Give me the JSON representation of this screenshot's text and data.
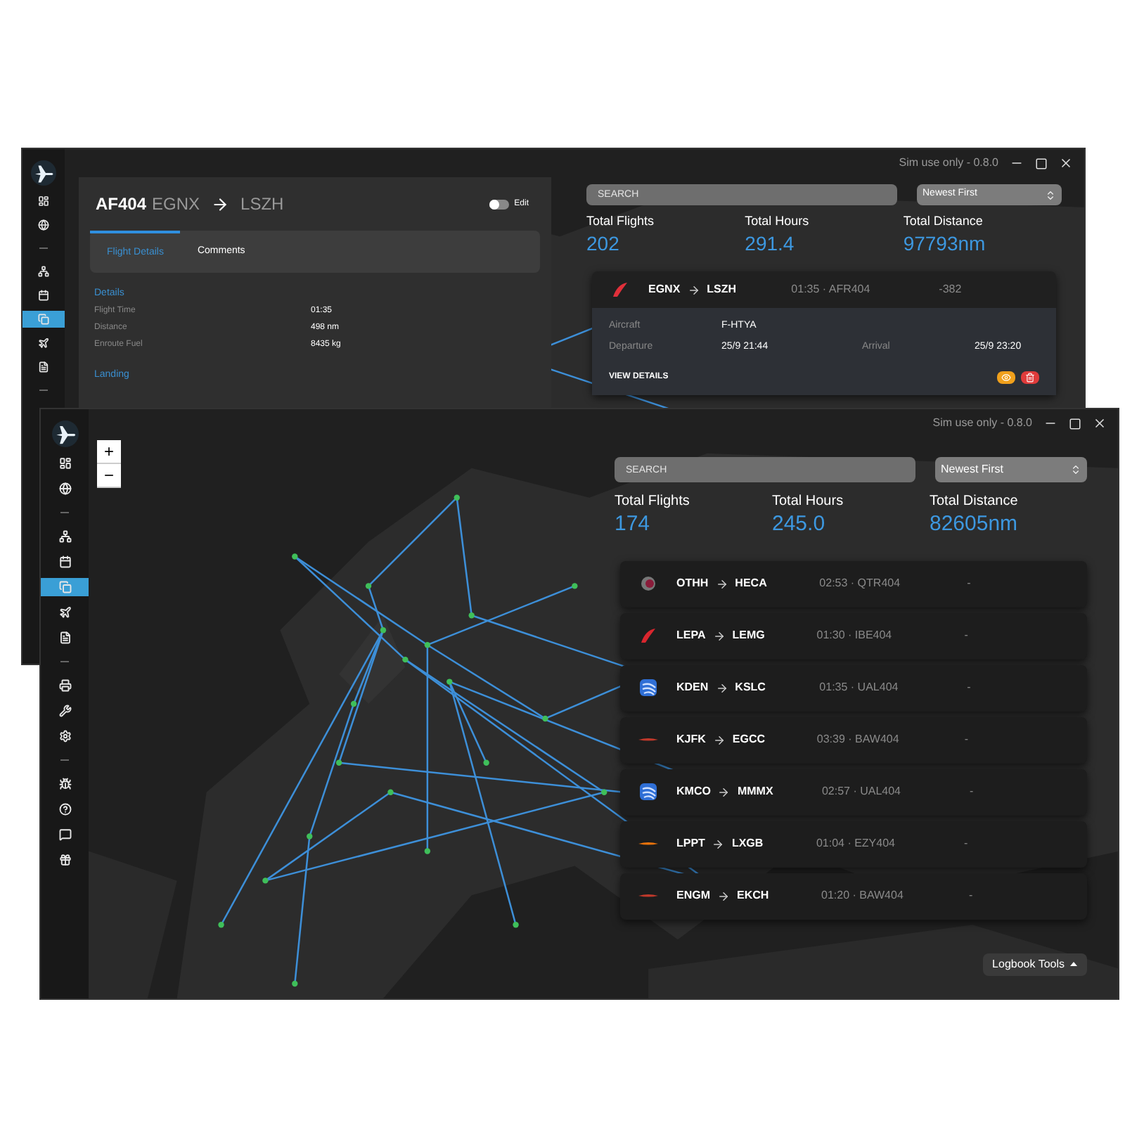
{
  "back_window": {
    "version": "Sim use only - 0.8.0",
    "sidebar": [
      {
        "kind": "icon",
        "selected": false
      },
      {
        "kind": "icon",
        "selected": false
      },
      {
        "kind": "separator"
      },
      {
        "kind": "icon",
        "selected": false
      },
      {
        "kind": "icon",
        "selected": false
      },
      {
        "kind": "icon",
        "selected": true
      },
      {
        "kind": "icon",
        "selected": false
      },
      {
        "kind": "icon",
        "selected": false
      },
      {
        "kind": "separator"
      }
    ],
    "flight_detail": {
      "callsign": "AF404",
      "from": "EGNX",
      "to": "LSZH",
      "edit_toggle": {
        "label": "Edit",
        "on": false
      },
      "tabs": [
        {
          "label": "Flight Details",
          "selected": true
        },
        {
          "label": "Comments",
          "selected": false
        }
      ],
      "section": "Details",
      "fields": [
        {
          "label": "Flight Time",
          "value": "01:35"
        },
        {
          "label": "Distance",
          "value": "498 nm"
        },
        {
          "label": "Enroute Fuel",
          "value": "8435 kg"
        }
      ],
      "next_section": "Landing"
    },
    "search": {
      "placeholder": "SEARCH"
    },
    "sort": "Newest First",
    "stats": [
      {
        "label": "Total Flights",
        "value": "202"
      },
      {
        "label": "Total Hours",
        "value": "291.4"
      },
      {
        "label": "Total Distance",
        "value": "97793nm"
      }
    ],
    "flights": [
      {
        "logo": {
          "kind": "swoosh",
          "color": "#e0303a"
        },
        "from": "EGNX",
        "to": "LSZH",
        "time": "01:35 · AFR404",
        "delta": "-382",
        "expanded": true,
        "details": [
          {
            "label": "Aircraft",
            "value": "F-HTYA"
          },
          {
            "label": "Departure",
            "value": "25/9 21:44"
          },
          {
            "label": "Arrival",
            "value": "25/9 23:20"
          }
        ],
        "view_details": "VIEW DETAILS"
      }
    ]
  },
  "front_window": {
    "version": "Sim use only - 0.8.0",
    "sidebar": [
      {
        "kind": "icon",
        "selected": false
      },
      {
        "kind": "icon",
        "selected": false
      },
      {
        "kind": "separator"
      },
      {
        "kind": "icon",
        "selected": false
      },
      {
        "kind": "icon",
        "selected": false
      },
      {
        "kind": "icon",
        "selected": true
      },
      {
        "kind": "icon",
        "selected": false
      },
      {
        "kind": "icon",
        "selected": false
      },
      {
        "kind": "separator"
      },
      {
        "kind": "icon",
        "selected": false
      },
      {
        "kind": "icon",
        "selected": false
      },
      {
        "kind": "icon",
        "selected": false
      },
      {
        "kind": "separator"
      },
      {
        "kind": "icon",
        "selected": false
      },
      {
        "kind": "icon",
        "selected": false
      },
      {
        "kind": "icon",
        "selected": false
      },
      {
        "kind": "icon",
        "selected": false
      }
    ],
    "zoom": [
      "+",
      "−"
    ],
    "search": {
      "placeholder": "SEARCH"
    },
    "sort": "Newest First",
    "stats": [
      {
        "label": "Total Flights",
        "value": "174"
      },
      {
        "label": "Total Hours",
        "value": "245.0"
      },
      {
        "label": "Total Distance",
        "value": "82605nm"
      }
    ],
    "flights": [
      {
        "logo": {
          "kind": "circle",
          "color": "#8a1c3a"
        },
        "from": "OTHH",
        "to": "HECA",
        "time": "02:53 · QTR404",
        "delta": "-"
      },
      {
        "logo": {
          "kind": "swoosh",
          "color": "#d9262e"
        },
        "from": "LEPA",
        "to": "LEMG",
        "time": "01:30 · IBE404",
        "delta": "-"
      },
      {
        "logo": {
          "kind": "globe",
          "color": "#2f6fd6"
        },
        "from": "KDEN",
        "to": "KSLC",
        "time": "01:35 · UAL404",
        "delta": "-"
      },
      {
        "logo": {
          "kind": "streak",
          "color": "#c0392b"
        },
        "from": "KJFK",
        "to": "EGCC",
        "time": "03:39 · BAW404",
        "delta": "-"
      },
      {
        "logo": {
          "kind": "globe",
          "color": "#2f6fd6"
        },
        "from": "KMCO",
        "to": "MMMX",
        "time": "02:57 · UAL404",
        "delta": "-"
      },
      {
        "logo": {
          "kind": "streak",
          "color": "#e8730c"
        },
        "from": "LPPT",
        "to": "LXGB",
        "time": "01:04 · EZY404",
        "delta": "-"
      },
      {
        "logo": {
          "kind": "streak",
          "color": "#c0392b"
        },
        "from": "ENGM",
        "to": "EKCH",
        "time": "01:20 · BAW404",
        "delta": "-"
      }
    ],
    "tools_button": "Logbook Tools"
  }
}
